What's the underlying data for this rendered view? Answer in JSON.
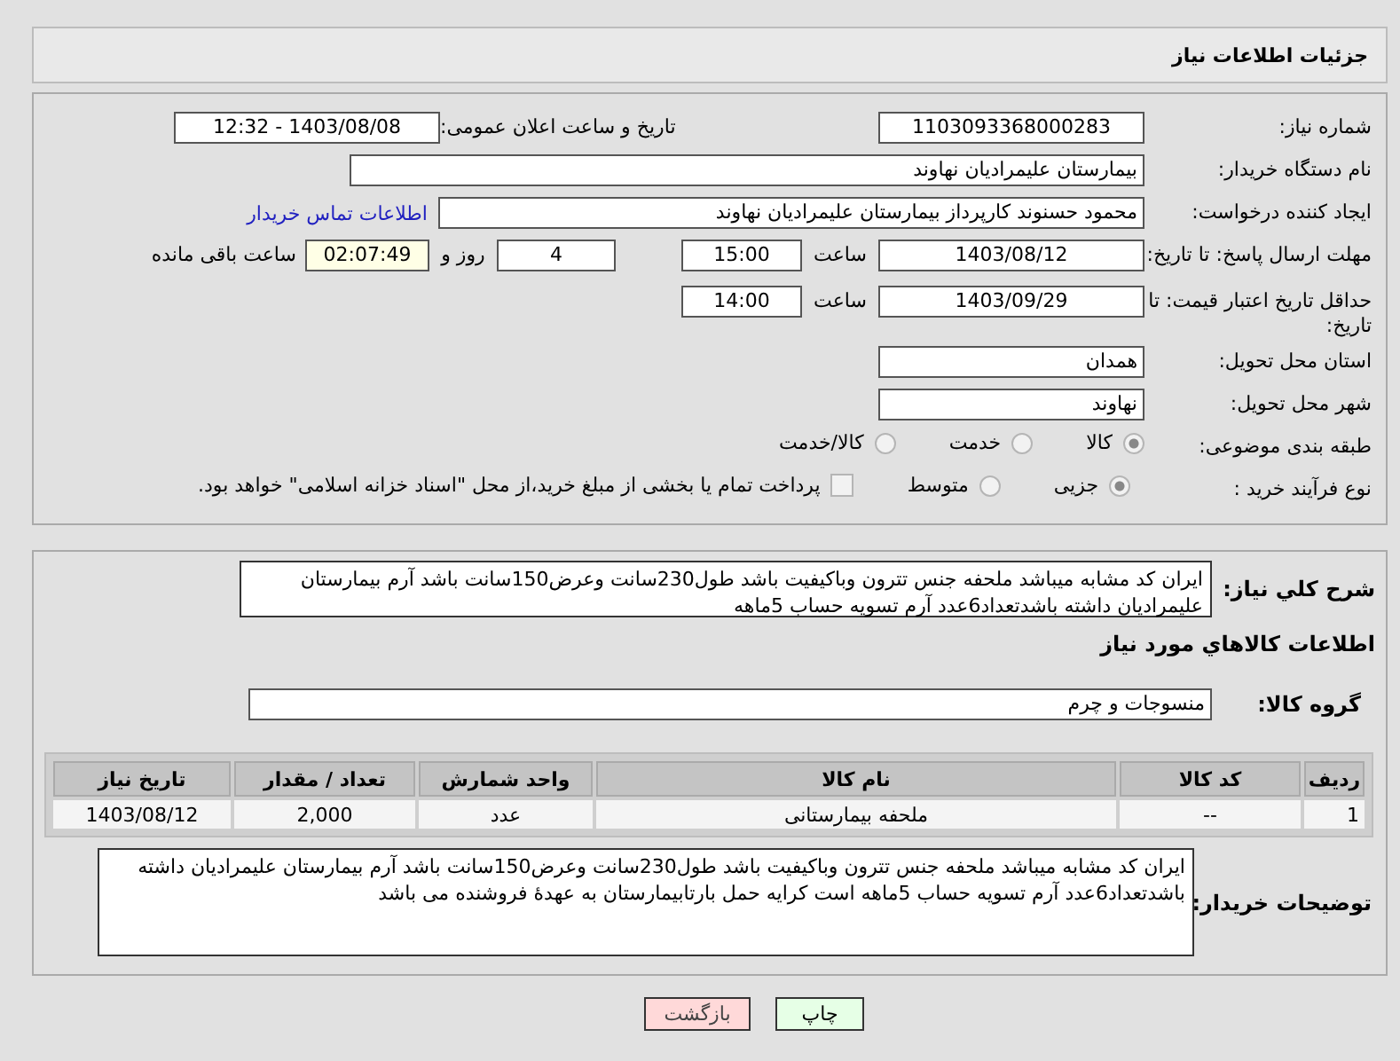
{
  "header": {
    "title": "جزئیات اطلاعات نیاز"
  },
  "form_rows": [
    {
      "label": "شماره نیاز:",
      "items": [
        {
          "kind": "field",
          "value": "1103093368000283"
        },
        {
          "kind": "text",
          "text": "تاریخ و ساعت اعلان عمومی:"
        },
        {
          "kind": "field",
          "value": "1403/08/08 - 12:32"
        }
      ]
    },
    {
      "label": "نام دستگاه خریدار:",
      "items": [
        {
          "kind": "field",
          "value": "بیمارستان علیمرادیان نهاوند"
        }
      ]
    },
    {
      "label": "ایجاد کننده درخواست:",
      "items": [
        {
          "kind": "field",
          "value": "محمود حسنوند کارپرداز بیمارستان علیمرادیان نهاوند"
        },
        {
          "kind": "link",
          "text": "اطلاعات تماس خریدار"
        }
      ]
    },
    {
      "label": "مهلت ارسال پاسخ: تا تاریخ:",
      "items": [
        {
          "kind": "field",
          "value": "1403/08/12"
        },
        {
          "kind": "text",
          "text": "ساعت"
        },
        {
          "kind": "field",
          "value": "15:00"
        },
        {
          "kind": "field",
          "value": "4"
        },
        {
          "kind": "text",
          "text": "روز و"
        },
        {
          "kind": "timer",
          "value": "02:07:49"
        },
        {
          "kind": "text",
          "text": "ساعت باقی مانده"
        }
      ]
    },
    {
      "label": "حداقل تاریخ اعتبار قیمت: تا تاریخ:",
      "items": [
        {
          "kind": "field",
          "value": "1403/09/29"
        },
        {
          "kind": "text",
          "text": "ساعت"
        },
        {
          "kind": "field",
          "value": "14:00"
        }
      ]
    },
    {
      "label": "استان محل تحویل:",
      "items": [
        {
          "kind": "field",
          "value": "همدان"
        }
      ]
    },
    {
      "label": "شهر محل تحویل:",
      "items": [
        {
          "kind": "field",
          "value": "نهاوند"
        }
      ]
    },
    {
      "label": "طبقه بندی موضوعی:",
      "items": [
        {
          "kind": "radio",
          "text": "کالا",
          "selected": true
        },
        {
          "kind": "radio",
          "text": "خدمت",
          "selected": false
        },
        {
          "kind": "radio",
          "text": "کالا/خدمت",
          "selected": false
        }
      ]
    },
    {
      "label": "نوع فرآیند خرید :",
      "items": [
        {
          "kind": "radio",
          "text": "جزیی",
          "selected": true
        },
        {
          "kind": "radio",
          "text": "متوسط",
          "selected": false
        },
        {
          "kind": "checkbox",
          "text": "پرداخت تمام یا بخشی از مبلغ خرید،از محل \"اسناد خزانه اسلامی\" خواهد بود.",
          "checked": false
        }
      ]
    }
  ],
  "description": {
    "label": "شرح کلي نياز:",
    "value": "ایران کد مشابه میباشد ملحفه جنس تترون وباکیفیت باشد طول230سانت وعرض150سانت باشد  آرم بیمارستان علیمرادیان داشته باشدتعداد6عدد آرم تسویه حساب 5ماهه"
  },
  "goods": {
    "title": "اطلاعات کالاهاي مورد نياز",
    "group_label": "گروه کالا:",
    "group_value": "منسوجات و چرم",
    "table": {
      "columns": [
        "رديف",
        "کد کالا",
        "نام کالا",
        "واحد شمارش",
        "تعداد / مقدار",
        "تاریخ نیاز"
      ],
      "rows": [
        [
          "1",
          "--",
          "ملحفه بیمارستانی",
          "عدد",
          "2,000",
          "1403/08/12"
        ]
      ]
    }
  },
  "buyer_notes": {
    "label": "توضیحات خریدار:",
    "value": "ایران کد مشابه میباشد ملحفه جنس تترون وباکیفیت باشد طول230سانت وعرض150سانت باشد  آرم بیمارستان علیمرادیان داشته باشدتعداد6عدد آرم تسویه حساب 5ماهه  است کرایه حمل بارتابیمارستان به عهدۀ فروشنده می باشد"
  },
  "buttons": [
    {
      "label": "چاپ",
      "kind": "print"
    },
    {
      "label": "بازگشت",
      "kind": "back"
    }
  ]
}
